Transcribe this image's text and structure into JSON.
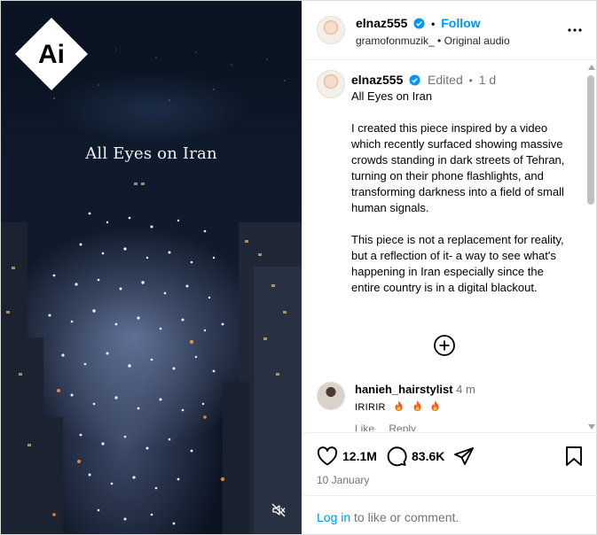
{
  "media": {
    "title": "All Eyes on Iran",
    "badge_text": "Ai",
    "mute_icon": "speaker-muted-icon"
  },
  "header": {
    "username": "elnaz555",
    "follow_label": "Follow",
    "audio_line": "gramofonmuzik_ • Original audio",
    "more_icon": "more-horizontal-icon"
  },
  "caption": {
    "username": "elnaz555",
    "edited": "Edited",
    "time": "1 d",
    "paragraphs": [
      "All Eyes on Iran",
      "I created this piece inspired by a video which recently surfaced showing massive crowds standing in dark streets of Tehran, turning on their phone flashlights, and transforming darkness into a field of small human signals.",
      "This piece is not a replacement for reality, but a reflection of it- a way to see what's happening in Iran especially since the entire country is in a digital blackout."
    ]
  },
  "comment": {
    "username": "hanieh_hairstylist",
    "time": "4 m",
    "text": "IRIRIR",
    "like_label": "Like",
    "reply_label": "Reply"
  },
  "actions": {
    "likes": "12.1M",
    "comments": "83.6K",
    "date": "10 January"
  },
  "footer": {
    "login_label": "Log in",
    "login_suffix": " to like or comment."
  },
  "colors": {
    "accent": "#0095f6",
    "verified": "#0095f6",
    "muted_text": "#737373"
  }
}
